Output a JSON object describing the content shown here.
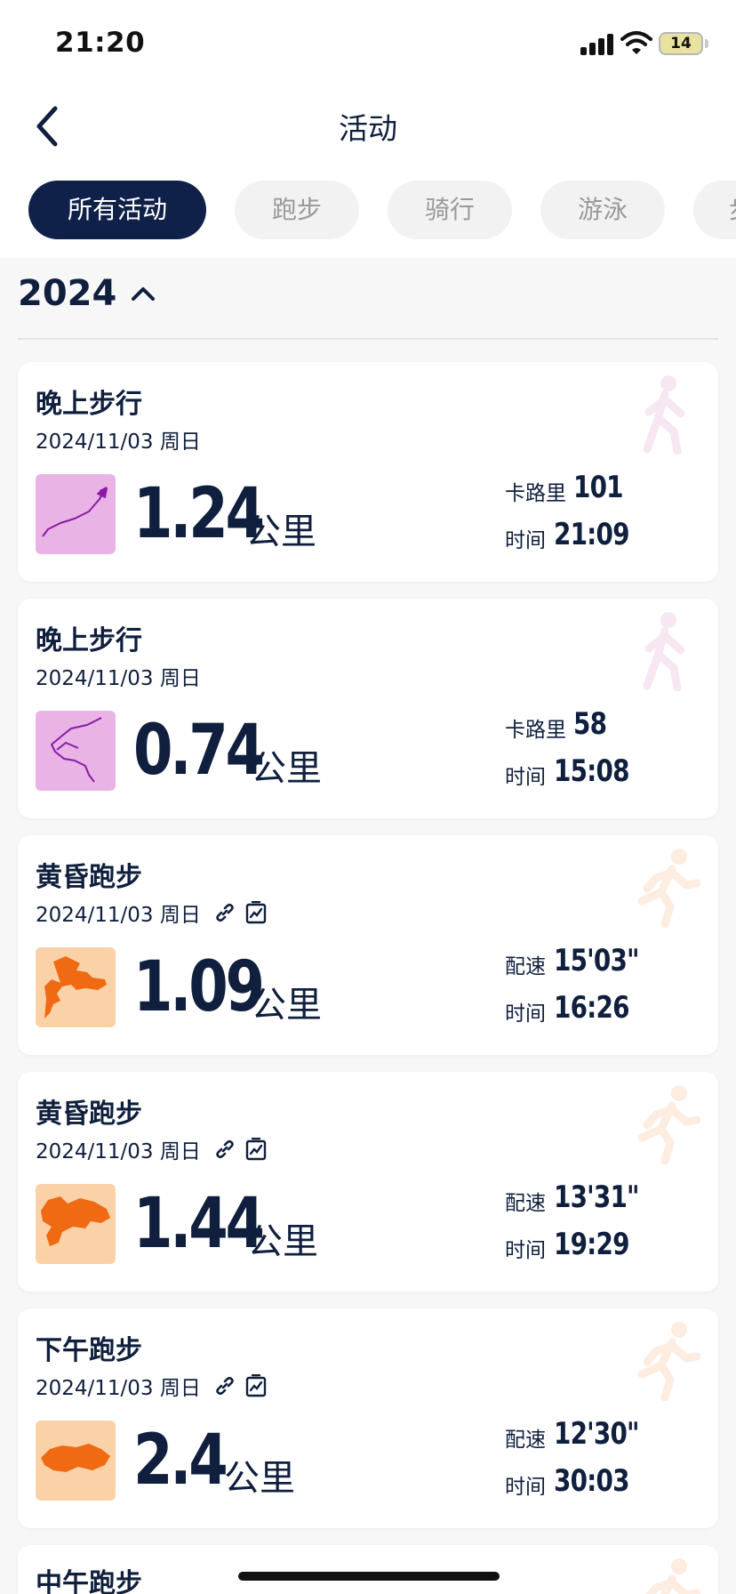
{
  "status_bar": {
    "time": "21:20",
    "battery": "14"
  },
  "nav": {
    "title": "活动"
  },
  "filters": [
    {
      "label": "所有活动",
      "active": true
    },
    {
      "label": "跑步",
      "active": false
    },
    {
      "label": "骑行",
      "active": false
    },
    {
      "label": "游泳",
      "active": false
    },
    {
      "label": "步",
      "active": false
    }
  ],
  "year": "2024",
  "unit_label": "公里",
  "activities": [
    {
      "title": "晚上步行",
      "date": "2024/11/03 周日",
      "type": "walk",
      "distance": "1.24",
      "stat1_label": "卡路里",
      "stat1_value": "101",
      "stat2_label": "时间",
      "stat2_value": "21:09"
    },
    {
      "title": "晚上步行",
      "date": "2024/11/03 周日",
      "type": "walk",
      "distance": "0.74",
      "stat1_label": "卡路里",
      "stat1_value": "58",
      "stat2_label": "时间",
      "stat2_value": "15:08"
    },
    {
      "title": "黄昏跑步",
      "date": "2024/11/03 周日",
      "type": "run",
      "distance": "1.09",
      "stat1_label": "配速",
      "stat1_value": "15'03\"",
      "stat2_label": "时间",
      "stat2_value": "16:26"
    },
    {
      "title": "黄昏跑步",
      "date": "2024/11/03 周日",
      "type": "run",
      "distance": "1.44",
      "stat1_label": "配速",
      "stat1_value": "13'31\"",
      "stat2_label": "时间",
      "stat2_value": "19:29"
    },
    {
      "title": "下午跑步",
      "date": "2024/11/03 周日",
      "type": "run",
      "distance": "2.4",
      "stat1_label": "配速",
      "stat1_value": "12'30\"",
      "stat2_label": "时间",
      "stat2_value": "30:03"
    },
    {
      "title": "中午跑步",
      "type": "run"
    }
  ],
  "colors": {
    "navy": "#0f2148",
    "walk_thumb_bg": "#e9b3e6",
    "walk_route": "#8a1aa6",
    "run_thumb_bg": "#fbd2a8",
    "run_route": "#ef6a12"
  },
  "icons": [
    "back-icon",
    "signal-icon",
    "wifi-icon",
    "battery-icon",
    "chevron-up-icon",
    "walking-person-icon",
    "running-person-icon",
    "link-icon",
    "chart-icon"
  ]
}
